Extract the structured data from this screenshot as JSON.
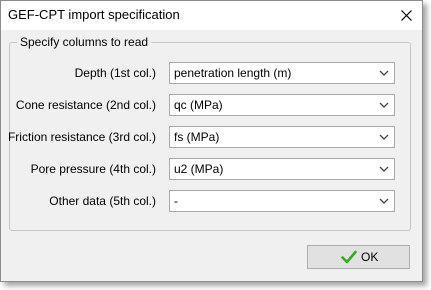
{
  "window": {
    "title": "GEF-CPT import specification"
  },
  "group": {
    "legend": "Specify columns to read"
  },
  "rows": [
    {
      "label": "Depth (1st col.)",
      "value": "penetration length (m)"
    },
    {
      "label": "Cone resistance (2nd col.)",
      "value": "qc (MPa)"
    },
    {
      "label": "Friction resistance (3rd col.)",
      "value": "fs (MPa)"
    },
    {
      "label": "Pore pressure (4th col.)",
      "value": "u2 (MPa)"
    },
    {
      "label": "Other data (5th col.)",
      "value": "-"
    }
  ],
  "buttons": {
    "ok_label": "OK"
  },
  "icons": {
    "close": "close-icon",
    "dropdown": "chevron-down-icon",
    "ok": "checkmark-icon"
  },
  "colors": {
    "dialog_background": "#f0f0f0",
    "titlebar_background": "#ffffff",
    "checkmark": "#3aa52c"
  }
}
